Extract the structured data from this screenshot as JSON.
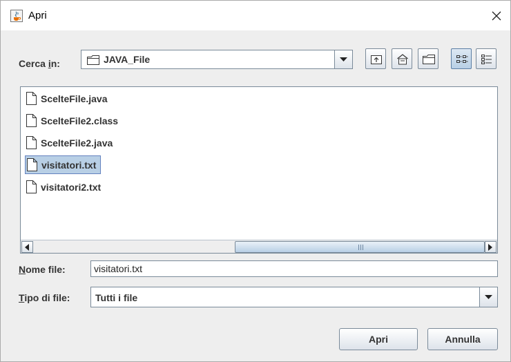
{
  "window": {
    "title": "Apri",
    "icon": "java-cup-icon",
    "close_icon": "close-icon"
  },
  "look_in": {
    "label_prefix": "Cerca ",
    "label_mnemonic": "i",
    "label_suffix": "n:",
    "selected_folder": "JAVA_File",
    "folder_icon": "folder-icon"
  },
  "toolbar": {
    "buttons": [
      {
        "icon": "up-one-level-icon",
        "active": false
      },
      {
        "icon": "home-icon",
        "active": false
      },
      {
        "icon": "new-folder-icon",
        "active": false
      },
      {
        "icon": "list-view-icon",
        "active": true
      },
      {
        "icon": "details-view-icon",
        "active": false
      }
    ]
  },
  "files": [
    {
      "name": "ScelteFile.java",
      "selected": false
    },
    {
      "name": "ScelteFile2.class",
      "selected": false
    },
    {
      "name": "ScelteFile2.java",
      "selected": false
    },
    {
      "name": "visitatori.txt",
      "selected": true
    },
    {
      "name": "visitatori2.txt",
      "selected": false
    }
  ],
  "file_name": {
    "label_mnemonic": "N",
    "label_rest": "ome file:",
    "value": "visitatori.txt"
  },
  "file_type": {
    "label_mnemonic": "T",
    "label_rest": "ipo di file:",
    "selected": "Tutti i file"
  },
  "buttons": {
    "open": "Apri",
    "cancel": "Annulla"
  },
  "colors": {
    "selection_bg": "#b8cfe5",
    "selection_border": "#6382bf",
    "border": "#7a8a99"
  }
}
